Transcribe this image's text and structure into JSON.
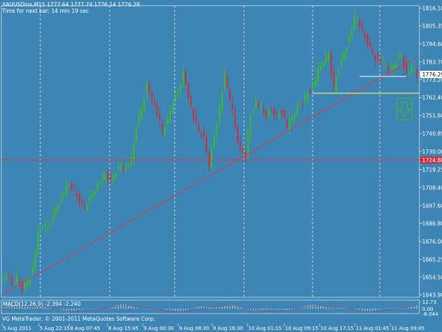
{
  "header": {
    "symbol_line": "XAUUSDins,M15  1777.64 1777.74 1776.14 1776.29",
    "timer_line": "Time for next bar: 14 min 19 sec"
  },
  "footer": {
    "copyright": "VG MetaTrader, © 2001-2011 MetaQuotes Software Corp."
  },
  "colors": {
    "background": "#3d85b4",
    "bull_candle": "#3cbe28",
    "bear_candle": "#c8323c",
    "trendline": "#e8324a",
    "support_line": "#e8324a",
    "resistance_line": "#f0e65a",
    "macd_histogram": "#c8c8c8",
    "macd_signal": "#c8323c",
    "arrow": "#3cbe28",
    "price_tag": "#c8323c",
    "text": "#ffffff"
  },
  "chart_data": {
    "type": "candlestick",
    "instrument": "XAUUSDins",
    "timeframe": "M15",
    "current_price": "1776.29",
    "support_price": "1724.88",
    "y_ticks": [
      "1816.10",
      "1805.35",
      "1794.60",
      "1783.70",
      "1773.20",
      "1762.40",
      "1751.60",
      "1740.85",
      "1730.00",
      "1719.25",
      "1708.40",
      "1697.60",
      "1686.80",
      "1676.00",
      "1665.25",
      "1654.50",
      "1643.90"
    ],
    "x_ticks": [
      "5 Aug 2011",
      "5 Aug 22:15",
      "8 Aug 07:45",
      "8 Aug 15:45",
      "9 Aug 00:30",
      "9 Aug 08:30",
      "9 Aug 16:30",
      "10 Aug 01:15",
      "10 Aug 09:15",
      "10 Aug 17:15",
      "11 Aug 01:45",
      "11 Aug 09:45"
    ],
    "close_path": [
      [
        0,
        1652
      ],
      [
        2,
        1656
      ],
      [
        4,
        1650
      ],
      [
        6,
        1654
      ],
      [
        8,
        1648
      ],
      [
        10,
        1652
      ],
      [
        12,
        1660
      ],
      [
        14,
        1680
      ],
      [
        16,
        1686
      ],
      [
        18,
        1684
      ],
      [
        20,
        1692
      ],
      [
        22,
        1700
      ],
      [
        24,
        1705
      ],
      [
        26,
        1710
      ],
      [
        28,
        1706
      ],
      [
        30,
        1700
      ],
      [
        32,
        1696
      ],
      [
        34,
        1702
      ],
      [
        36,
        1708
      ],
      [
        38,
        1712
      ],
      [
        40,
        1716
      ],
      [
        42,
        1712
      ],
      [
        44,
        1718
      ],
      [
        46,
        1722
      ],
      [
        48,
        1720
      ],
      [
        50,
        1725
      ],
      [
        52,
        1745
      ],
      [
        54,
        1756
      ],
      [
        56,
        1770
      ],
      [
        58,
        1762
      ],
      [
        60,
        1752
      ],
      [
        62,
        1742
      ],
      [
        64,
        1748
      ],
      [
        66,
        1760
      ],
      [
        68,
        1766
      ],
      [
        70,
        1777
      ],
      [
        72,
        1764
      ],
      [
        74,
        1750
      ],
      [
        76,
        1742
      ],
      [
        78,
        1738
      ],
      [
        80,
        1722
      ],
      [
        82,
        1740
      ],
      [
        84,
        1757
      ],
      [
        86,
        1775
      ],
      [
        88,
        1762
      ],
      [
        90,
        1745
      ],
      [
        92,
        1730
      ],
      [
        94,
        1728
      ],
      [
        96,
        1752
      ],
      [
        98,
        1760
      ],
      [
        100,
        1755
      ],
      [
        102,
        1752
      ],
      [
        104,
        1755
      ],
      [
        106,
        1752
      ],
      [
        108,
        1754
      ],
      [
        110,
        1745
      ],
      [
        112,
        1750
      ],
      [
        114,
        1756
      ],
      [
        116,
        1760
      ],
      [
        118,
        1765
      ],
      [
        120,
        1770
      ],
      [
        122,
        1778
      ],
      [
        124,
        1784
      ],
      [
        126,
        1788
      ],
      [
        128,
        1768
      ],
      [
        130,
        1780
      ],
      [
        132,
        1790
      ],
      [
        134,
        1798
      ],
      [
        136,
        1810
      ],
      [
        138,
        1806
      ],
      [
        140,
        1798
      ],
      [
        142,
        1792
      ],
      [
        144,
        1786
      ],
      [
        146,
        1784
      ],
      [
        148,
        1780
      ],
      [
        150,
        1779
      ],
      [
        152,
        1785
      ],
      [
        154,
        1788
      ],
      [
        156,
        1776
      ],
      [
        158,
        1780
      ],
      [
        160,
        1776
      ]
    ],
    "trend_line_from": [
      0,
      1643.9
    ],
    "trend_line_to": [
      160,
      1786.5
    ],
    "resistance_line_from": [
      120,
      1765
    ],
    "resistance_line_to": [
      161,
      1765
    ],
    "short_level_from": [
      138,
      1775
    ],
    "short_level_to": [
      156,
      1775
    ],
    "indicator": {
      "label": "MACD(12,26,9) -2.394 -2.240",
      "y_ticks": [
        "12.73",
        "0.00",
        "-8.044"
      ]
    }
  }
}
